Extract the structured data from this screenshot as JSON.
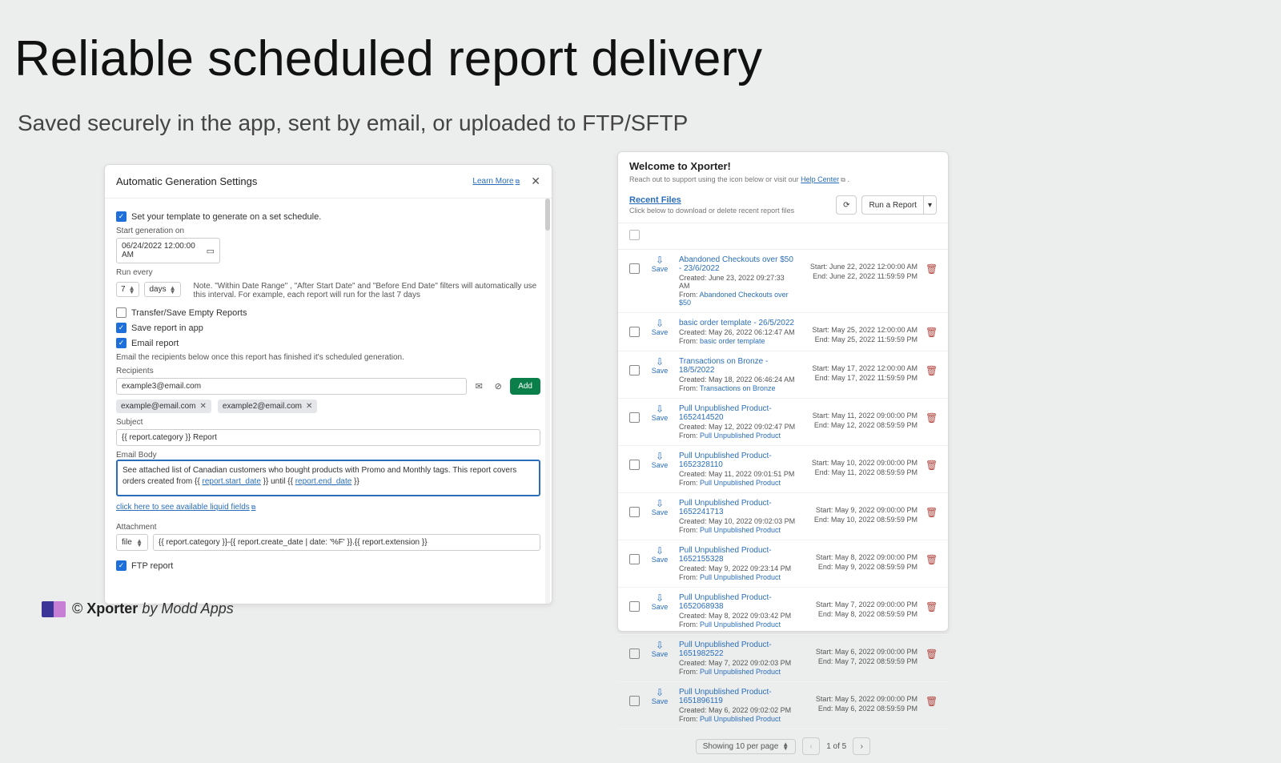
{
  "hero": {
    "title": "Reliable scheduled report delivery",
    "subtitle": "Saved securely in the app, sent by email, or uploaded to FTP/SFTP"
  },
  "brand": {
    "copyright": "©",
    "name": "Xporter",
    "by": "by Modd Apps"
  },
  "settings": {
    "title": "Automatic Generation Settings",
    "learn_more": "Learn More",
    "close": "✕",
    "schedule_check": "Set your template to generate on a set schedule.",
    "start_label": "Start generation on",
    "start_value": "06/24/2022 12:00:00 AM",
    "run_every_label": "Run every",
    "run_every_value": "7",
    "run_every_unit": "days",
    "note": "Note. \"Within Date Range\" , \"After Start Date\" and \"Before End Date\" filters will automatically use this interval. For example, each report will run for the last 7 days",
    "transfer_empty": "Transfer/Save Empty Reports",
    "save_in_app": "Save report in app",
    "email_report": "Email report",
    "email_hint": "Email the recipients below once this report has finished it's scheduled generation.",
    "recipients_label": "Recipients",
    "recipient_input": "example3@email.com",
    "add": "Add",
    "chips": [
      "example@email.com",
      "example2@email.com"
    ],
    "subject_label": "Subject",
    "subject_value": "{{ report.category }} Report",
    "body_label": "Email Body",
    "body_text_a": "See attached list of Canadian customers who bought products with Promo and Monthly tags.  This report covers orders created from {{ ",
    "body_link_1": "report.start_date",
    "body_mid": " }} until {{ ",
    "body_link_2": "report.end_date",
    "body_end": " }}",
    "liquid_link": "click here to see available liquid fields",
    "attachment_label": "Attachment",
    "attachment_type": "file",
    "attachment_value": "{{ report.category }}-{{ report.create_date | date: '%F' }}.{{ report.extension }}",
    "ftp_report": "FTP report"
  },
  "welcome": {
    "title": "Welcome to Xporter!",
    "sub_prefix": "Reach out to support using the icon below or visit our ",
    "sub_link": "Help Center",
    "recent_files": "Recent Files",
    "recent_sub": "Click below to download or delete recent report files",
    "run_report": "Run a Report",
    "save_label": "Save",
    "from_label": "From:",
    "created_label": "Created:",
    "start_label": "Start:",
    "end_label": "End:",
    "pager_showing": "Showing 10 per page",
    "pager_pos": "1 of 5",
    "files": [
      {
        "name": "Abandoned Checkouts over $50 - 23/6/2022",
        "created": "June 23, 2022 09:27:33 AM",
        "from": "Abandoned Checkouts over $50",
        "start": "June 22, 2022 12:00:00 AM",
        "end": "June 22, 2022 11:59:59 PM"
      },
      {
        "name": "basic order template - 26/5/2022",
        "created": "May 26, 2022 06:12:47 AM",
        "from": "basic order template",
        "start": "May 25, 2022 12:00:00 AM",
        "end": "May 25, 2022 11:59:59 PM"
      },
      {
        "name": "Transactions on Bronze - 18/5/2022",
        "created": "May 18, 2022 06:46:24 AM",
        "from": "Transactions on Bronze",
        "start": "May 17, 2022 12:00:00 AM",
        "end": "May 17, 2022 11:59:59 PM"
      },
      {
        "name": "Pull Unpublished Product-1652414520",
        "created": "May 12, 2022 09:02:47 PM",
        "from": "Pull Unpublished Product",
        "start": "May 11, 2022 09:00:00 PM",
        "end": "May 12, 2022 08:59:59 PM"
      },
      {
        "name": "Pull Unpublished Product-1652328110",
        "created": "May 11, 2022 09:01:51 PM",
        "from": "Pull Unpublished Product",
        "start": "May 10, 2022 09:00:00 PM",
        "end": "May 11, 2022 08:59:59 PM"
      },
      {
        "name": "Pull Unpublished Product-1652241713",
        "created": "May 10, 2022 09:02:03 PM",
        "from": "Pull Unpublished Product",
        "start": "May 9, 2022 09:00:00 PM",
        "end": "May 10, 2022 08:59:59 PM"
      },
      {
        "name": "Pull Unpublished Product-1652155328",
        "created": "May 9, 2022 09:23:14 PM",
        "from": "Pull Unpublished Product",
        "start": "May 8, 2022 09:00:00 PM",
        "end": "May 9, 2022 08:59:59 PM"
      },
      {
        "name": "Pull Unpublished Product-1652068938",
        "created": "May 8, 2022 09:03:42 PM",
        "from": "Pull Unpublished Product",
        "start": "May 7, 2022 09:00:00 PM",
        "end": "May 8, 2022 08:59:59 PM"
      },
      {
        "name": "Pull Unpublished Product-1651982522",
        "created": "May 7, 2022 09:02:03 PM",
        "from": "Pull Unpublished Product",
        "start": "May 6, 2022 09:00:00 PM",
        "end": "May 7, 2022 08:59:59 PM"
      },
      {
        "name": "Pull Unpublished Product-1651896119",
        "created": "May 6, 2022 09:02:02 PM",
        "from": "Pull Unpublished Product",
        "start": "May 5, 2022 09:00:00 PM",
        "end": "May 6, 2022 08:59:59 PM"
      }
    ]
  }
}
